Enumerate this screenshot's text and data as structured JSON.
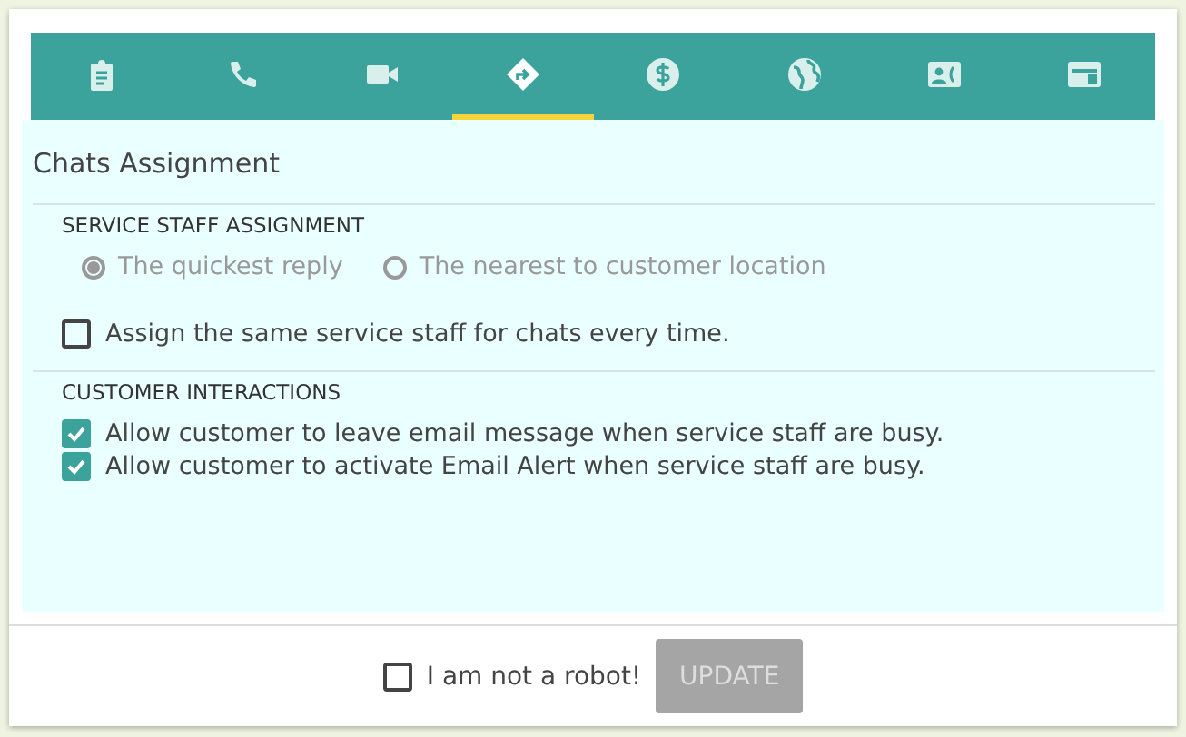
{
  "tabs": [
    {
      "kind": "clipboard",
      "selected": false
    },
    {
      "kind": "phone",
      "selected": false
    },
    {
      "kind": "video",
      "selected": false
    },
    {
      "kind": "directions",
      "selected": true
    },
    {
      "kind": "dollar",
      "selected": false
    },
    {
      "kind": "globe",
      "selected": false
    },
    {
      "kind": "contact",
      "selected": false
    },
    {
      "kind": "web",
      "selected": false
    }
  ],
  "title": "Chats Assignment",
  "sections": [
    {
      "heading": "SERVICE STAFF ASSIGNMENT",
      "radios_disabled": true,
      "radios": [
        {
          "label": "The quickest reply",
          "selected": true
        },
        {
          "label": "The nearest to customer location",
          "selected": false
        }
      ],
      "checkboxes": [
        {
          "label": "Assign the same service staff for chats every time.",
          "checked": false
        }
      ]
    },
    {
      "heading": "CUSTOMER INTERACTIONS",
      "checkboxes": [
        {
          "label": "Allow customer to leave email message when service staff are busy.",
          "checked": true
        },
        {
          "label": "Allow customer to activate Email Alert when service staff are busy.",
          "checked": true
        }
      ]
    }
  ],
  "footer": {
    "captcha": {
      "label": "I am not a robot!",
      "checked": false
    },
    "button": {
      "label": "UPDATE",
      "disabled": true
    }
  }
}
